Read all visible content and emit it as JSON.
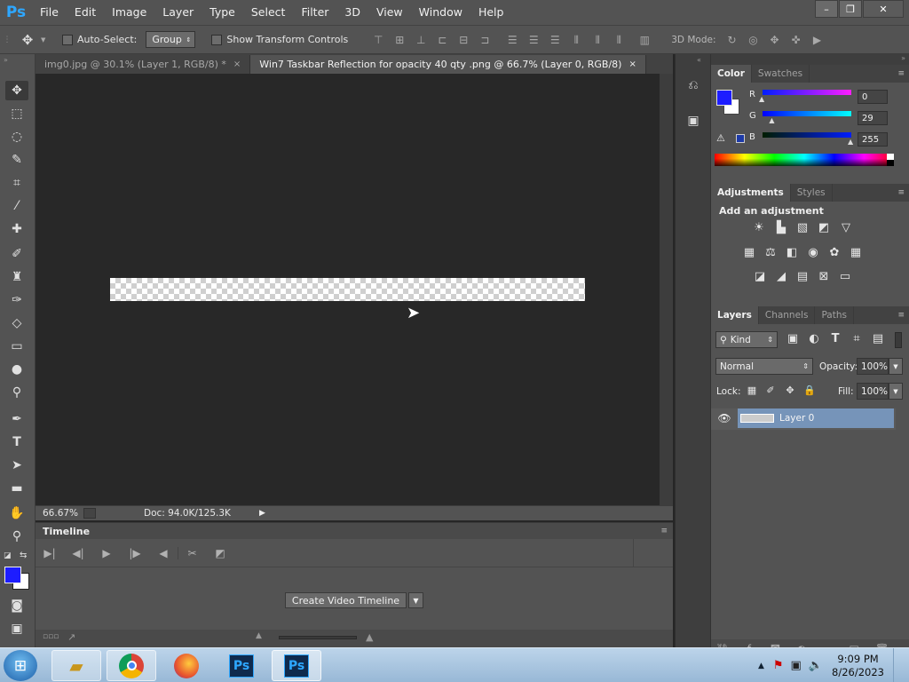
{
  "app": {
    "logo": "Ps"
  },
  "menu": [
    "File",
    "Edit",
    "Image",
    "Layer",
    "Type",
    "Select",
    "Filter",
    "3D",
    "View",
    "Window",
    "Help"
  ],
  "window_controls": {
    "minimize": "–",
    "restore": "❐",
    "close": "✕"
  },
  "options_bar": {
    "auto_select_label": "Auto-Select:",
    "auto_select_value": "Group",
    "transform_label": "Show Transform Controls",
    "mode_label": "3D Mode:"
  },
  "tabs": [
    {
      "label": "img0.jpg @ 30.1% (Layer 1, RGB/8) *",
      "close": "×"
    },
    {
      "label": "Win7 Taskbar Reflection for opacity 40 qty .png @ 66.7% (Layer 0, RGB/8)",
      "close": "×"
    }
  ],
  "status": {
    "zoom": "66.67%",
    "doc": "Doc: 94.0K/125.3K"
  },
  "timeline": {
    "title": "Timeline",
    "create_button": "Create Video Timeline"
  },
  "color_panel": {
    "tabs": [
      "Color",
      "Swatches"
    ],
    "channels": [
      {
        "label": "R",
        "value": "0",
        "fraction": 0
      },
      {
        "label": "G",
        "value": "29",
        "fraction": 0.114
      },
      {
        "label": "B",
        "value": "255",
        "fraction": 1
      }
    ],
    "foreground": "#1d1dff",
    "background": "#ffffff"
  },
  "adjustments_panel": {
    "tabs": [
      "Adjustments",
      "Styles"
    ],
    "heading": "Add an adjustment"
  },
  "layers_panel": {
    "tabs": [
      "Layers",
      "Channels",
      "Paths"
    ],
    "filter_kind": "Kind",
    "blend_mode": "Normal",
    "opacity_label": "Opacity:",
    "opacity_value": "100%",
    "lock_label": "Lock:",
    "fill_label": "Fill:",
    "fill_value": "100%",
    "layers": [
      {
        "name": "Layer 0"
      }
    ]
  },
  "taskbar": {
    "time": "9:09 PM",
    "date": "8/26/2023",
    "ps_label": "Ps"
  }
}
